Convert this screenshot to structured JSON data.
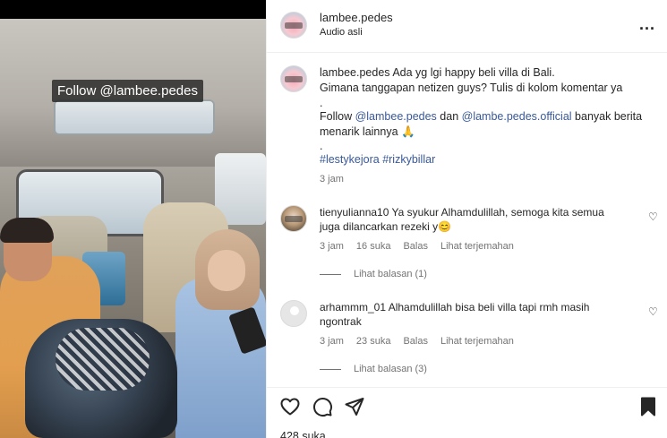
{
  "media": {
    "watermark": "Follow @lambee.pedes"
  },
  "header": {
    "username": "lambee.pedes",
    "subtitle": "Audio asli",
    "more": "..."
  },
  "caption": {
    "username": "lambee.pedes",
    "line1": "Ada yg lgi happy beli villa di Bali.",
    "line2": "Gimana tanggapan netizen guys? Tulis di kolom komentar ya",
    "dot1": ".",
    "follow_prefix": "Follow ",
    "mention1": "@lambee.pedes",
    "and": " dan ",
    "mention2": "@lambe.pedes.official",
    "follow_suffix": " banyak berita",
    "line5": "menarik lainnya 🙏",
    "dot2": ".",
    "hashtag1": "#lestykejora",
    "hashtag2": "#rizkybillar",
    "time": "3 jam"
  },
  "comments": [
    {
      "username": "tienyulianna10",
      "text1": "Ya syukur Alhamdulillah, semoga kita semua",
      "text2": "juga dilancarkan rezeki y😊",
      "time": "3 jam",
      "likes": "16 suka",
      "reply": "Balas",
      "translate": "Lihat terjemahan",
      "view_replies": "Lihat balasan (1)"
    },
    {
      "username": "arhammm_01",
      "text1": "Alhamdulillah bisa beli villa tapi rmh masih",
      "text2": "ngontrak",
      "time": "3 jam",
      "likes": "23 suka",
      "reply": "Balas",
      "translate": "Lihat terjemahan",
      "view_replies": "Lihat balasan (3)"
    }
  ],
  "actions": {
    "like_icon": "heart-icon",
    "comment_icon": "comment-icon",
    "share_icon": "share-icon",
    "save_icon": "bookmark-icon",
    "likes": "428 suka"
  },
  "colors": {
    "link": "#385898",
    "muted": "#737373",
    "text": "#262626"
  }
}
